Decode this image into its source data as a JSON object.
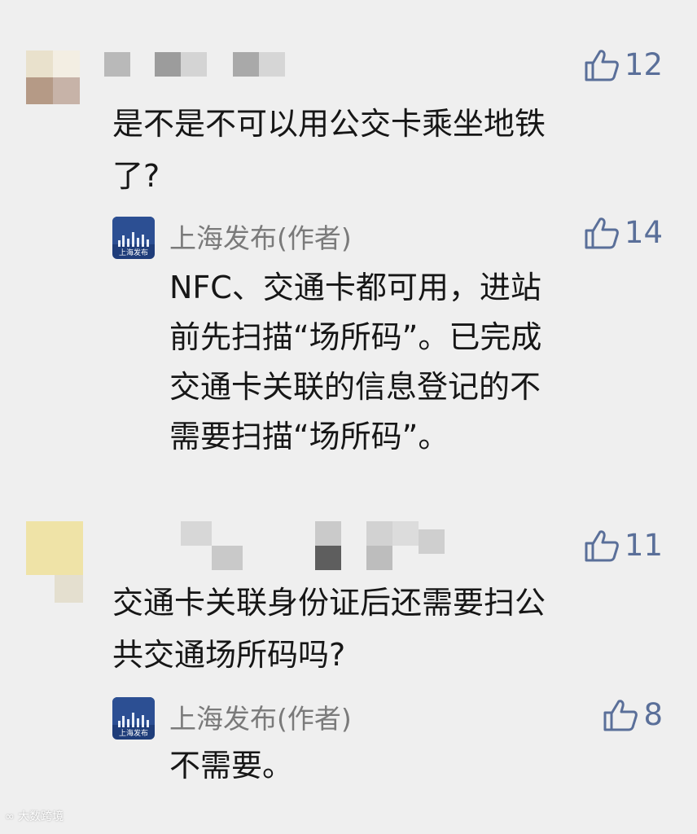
{
  "comments": [
    {
      "likes": "12",
      "text_lines": [
        "是不是不可以用公交卡乘坐地铁",
        "了?"
      ],
      "reply": {
        "author": "上海发布(作者)",
        "avatar_label": "上海发布",
        "likes": "14",
        "text_lines": [
          "NFC、交通卡都可用，进站",
          "前先扫描“场所码”。已完成",
          "交通卡关联的信息登记的不",
          "需要扫描“场所码”。"
        ]
      }
    },
    {
      "likes": "11",
      "text_lines": [
        "交通卡关联身份证后还需要扫公",
        "共交通场所码吗?"
      ],
      "reply": {
        "author": "上海发布(作者)",
        "avatar_label": "上海发布",
        "likes": "8",
        "text_lines": [
          "不需要。"
        ]
      }
    }
  ],
  "watermark": "大数跨境",
  "colors": {
    "like": "#5a6f99",
    "author": "#7a7a7a",
    "text": "#161616",
    "background": "#efefef",
    "avatar": "#1f3d7a"
  },
  "icons": {
    "like": "thumbs-up-icon"
  }
}
